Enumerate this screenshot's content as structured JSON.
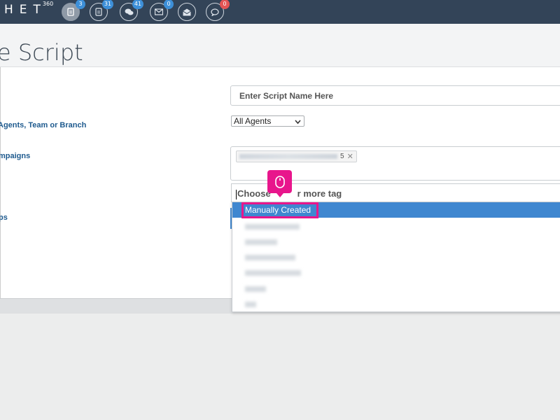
{
  "topbar": {
    "logo_text": "HET",
    "logo_sup": "360",
    "icons": [
      {
        "name": "scripts-icon",
        "badge": "3"
      },
      {
        "name": "reports-icon",
        "badge": "31"
      },
      {
        "name": "chat-icon",
        "badge": "41"
      },
      {
        "name": "mail-icon",
        "badge": "0"
      },
      {
        "name": "inbox-icon",
        "badge": ""
      },
      {
        "name": "comments-icon",
        "badge": "0"
      }
    ]
  },
  "page": {
    "title": "e Script"
  },
  "form": {
    "labels": {
      "agents": "Agents, Team or Branch",
      "campaigns": "mpaigns",
      "tags": "ps"
    },
    "script_name_placeholder": "Enter Script Name Here",
    "agent_select_value": "All Agents",
    "campaign_chip_suffix": "5",
    "tag_placeholder_start": "Choose",
    "tag_placeholder_end": "r more tag"
  },
  "dropdown": {
    "selected": "Manually Created"
  },
  "colors": {
    "accent": "#e8168c",
    "selected_option": "#3f87d0",
    "topbar": "#334458",
    "label": "#1e5a8e"
  }
}
